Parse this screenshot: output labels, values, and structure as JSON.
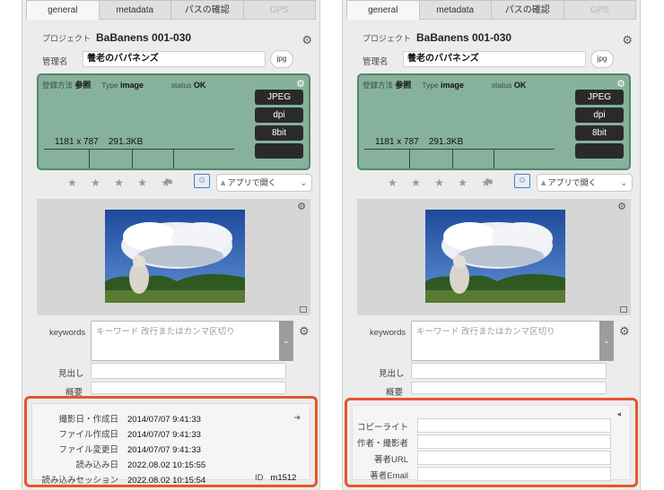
{
  "tabs": [
    "general",
    "metadata",
    "パスの確認",
    "GPS"
  ],
  "project": {
    "label": "プロジェクト",
    "name": "BaBanens 001-030"
  },
  "manager": {
    "label": "管理名",
    "value": "養老のバパネンズ",
    "button": "jpg"
  },
  "info": {
    "reg_label": "登録方法",
    "reg_value": "参照",
    "type_label": "Type",
    "type_value": "image",
    "status_label": "status",
    "status_value": "OK",
    "buttons": [
      "JPEG",
      "dpi",
      "8bit"
    ],
    "dims": "1181 x 787",
    "size": "291.3KB"
  },
  "rating": "★ ★ ★ ★ ★",
  "flag": "⚑",
  "open_app": "アプリで開く",
  "keywords": {
    "label": "keywords",
    "placeholder": "キーワード 改行またはカンマ区切り"
  },
  "headline": {
    "label": "見出し"
  },
  "summary": {
    "label": "概要"
  },
  "dates": [
    {
      "k": "撮影日・作成日",
      "v": "2014/07/07 9:41:33"
    },
    {
      "k": "ファイル作成日",
      "v": "2014/07/07 9:41:33"
    },
    {
      "k": "ファイル変更日",
      "v": "2014/07/07 9:41:33"
    },
    {
      "k": "読み込み日",
      "v": "2022.08.02 10:15:55"
    },
    {
      "k": "読み込みセッション",
      "v": "2022.08.02 10:15:54"
    }
  ],
  "id": {
    "label": "ID",
    "value": "m1512"
  },
  "rights": [
    {
      "k": "コピーライト"
    },
    {
      "k": "作者・撮影者"
    },
    {
      "k": "著者URL"
    },
    {
      "k": "著者Email"
    }
  ]
}
